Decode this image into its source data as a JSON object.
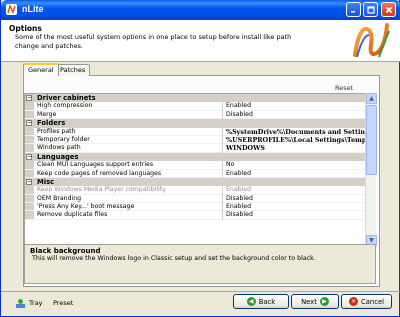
{
  "window": {
    "title": "nLite"
  },
  "header": {
    "title": "Options",
    "description": "Some of the most useful system options in one place to setup before install like path change and patches."
  },
  "tabs": [
    {
      "label": "General",
      "active": true
    },
    {
      "label": "Patches",
      "active": false
    }
  ],
  "reset_label": "Reset",
  "grid": {
    "categories": [
      {
        "label": "Driver cabinets",
        "items": [
          {
            "name": "High compression",
            "value": "Enabled"
          },
          {
            "name": "Merge",
            "value": "Disabled"
          }
        ]
      },
      {
        "label": "Folders",
        "items": [
          {
            "name": "Profiles path",
            "value": "%SystemDrive%\\Documents and Settings"
          },
          {
            "name": "Temporary folder",
            "value": "%USERPROFILE%\\Local Settings\\Temp"
          },
          {
            "name": "Windows path",
            "value": "WINDOWS"
          }
        ]
      },
      {
        "label": "Languages",
        "items": [
          {
            "name": "Clean MUI Languages support entries",
            "value": "No"
          },
          {
            "name": "Keep code pages of removed languages",
            "value": "Enabled"
          }
        ]
      },
      {
        "label": "Misc",
        "items": [
          {
            "name": "Keep Windows Media Player compatibility",
            "value": "Enabled"
          },
          {
            "name": "OEM Branding",
            "value": "Disabled"
          },
          {
            "name": "'Press Any Key...' boot message",
            "value": "Enabled"
          },
          {
            "name": "Remove duplicate files",
            "value": "Disabled"
          }
        ]
      }
    ]
  },
  "description_box": {
    "title": "Black background",
    "text": "This will remove the Windows logo in Classic setup and set the background color to black."
  },
  "footer": {
    "tray_label": "Tray",
    "preset_label": "Preset",
    "back_label": "Back",
    "next_label": "Next",
    "cancel_label": "Cancel"
  },
  "colors": {
    "titlebar": "#0058ee",
    "dialog_bg": "#ece9d8",
    "tab_highlight": "#ffc83c"
  }
}
